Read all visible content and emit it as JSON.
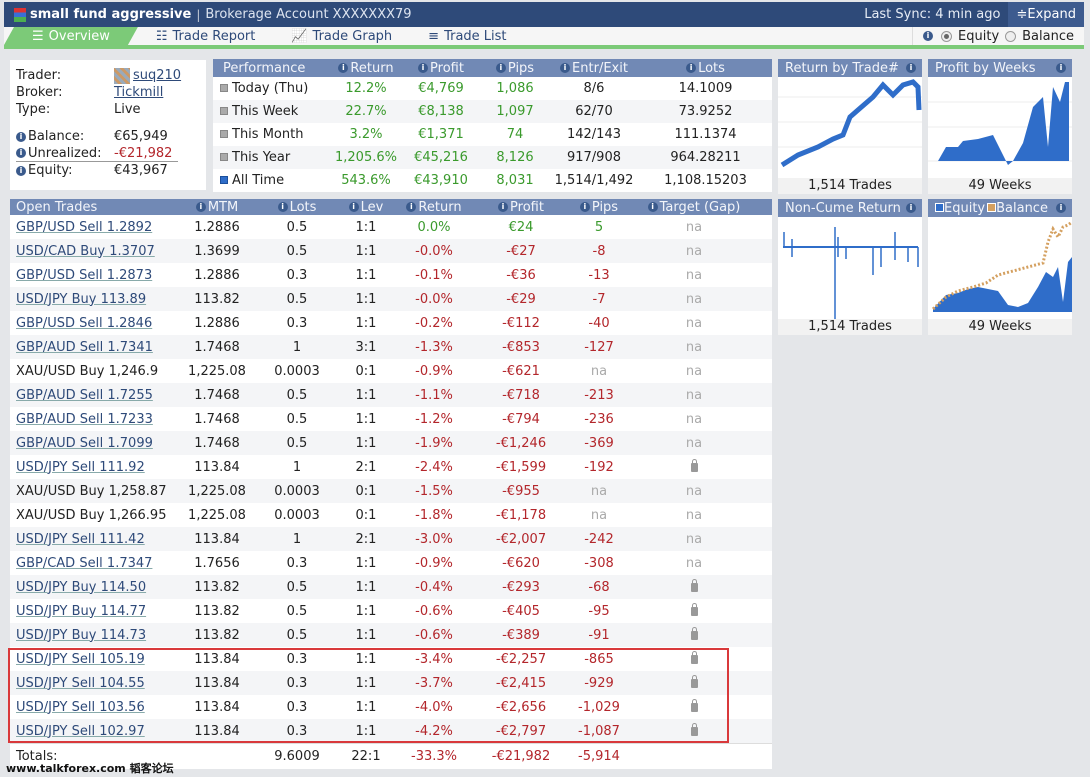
{
  "header": {
    "name": "small fund aggressive",
    "separator": "|",
    "account": "Brokerage Account XXXXXXX79",
    "sync": "Last Sync: 4 min ago",
    "expand": "≑Expand"
  },
  "tabs": [
    {
      "label": "Overview",
      "icon": "☰"
    },
    {
      "label": "Trade Report",
      "icon": "☷"
    },
    {
      "label": "Trade Graph",
      "icon": "📈"
    },
    {
      "label": "Trade List",
      "icon": "≡"
    }
  ],
  "mode": {
    "equity": "Equity",
    "balance": "Balance",
    "selected": "Equity"
  },
  "info": {
    "trader_label": "Trader:",
    "trader": "suq210",
    "broker_label": "Broker:",
    "broker": "Tickmill",
    "type_label": "Type:",
    "type": "Live",
    "balance_label": "Balance:",
    "balance": "€65,949",
    "unrealized_label": "Unrealized:",
    "unrealized": "-€21,982",
    "equity_label": "Equity:",
    "equity": "€43,967"
  },
  "performance": {
    "headers": [
      "Performance",
      "Return",
      "Profit",
      "Pips",
      "Entr/Exit",
      "Lots"
    ],
    "rows": [
      [
        "Today (Thu)",
        "12.2%",
        "€4,769",
        "1,086",
        "8/6",
        "14.1009"
      ],
      [
        "This Week",
        "22.7%",
        "€8,138",
        "1,097",
        "62/70",
        "73.9252"
      ],
      [
        "This Month",
        "3.2%",
        "€1,371",
        "74",
        "142/143",
        "111.1374"
      ],
      [
        "This Year",
        "1,205.6%",
        "€45,216",
        "8,126",
        "917/908",
        "964.28211"
      ],
      [
        "All Time",
        "543.6%",
        "€43,910",
        "8,031",
        "1,514/1,492",
        "1,108.15203"
      ]
    ]
  },
  "panels": {
    "return_by_trade": {
      "title": "Return by Trade#",
      "foot": "1,514 Trades"
    },
    "profit_by_weeks": {
      "title": "Profit by Weeks",
      "foot": "49 Weeks"
    },
    "non_cume": {
      "title": "Non-Cume Return",
      "foot": "1,514 Trades"
    },
    "equity_balance": {
      "equity": "Equity",
      "balance": "Balance",
      "foot": "49 Weeks",
      "equity_color": "#2f6dc9",
      "balance_color": "#d4a060"
    }
  },
  "trades": {
    "headers": [
      "Open Trades",
      "MTM",
      "Lots",
      "Lev",
      "Return",
      "Profit",
      "Pips",
      "Target (Gap)"
    ],
    "rows": [
      [
        "GBP/USD Sell 1.2892",
        "1.2886",
        "0.5",
        "1:1",
        "0.0%",
        "€24",
        "5",
        "na",
        true,
        "pos"
      ],
      [
        "USD/CAD Buy 1.3707",
        "1.3699",
        "0.5",
        "1:1",
        "-0.0%",
        "-€27",
        "-8",
        "na",
        true,
        "neg"
      ],
      [
        "GBP/USD Sell 1.2873",
        "1.2886",
        "0.3",
        "1:1",
        "-0.1%",
        "-€36",
        "-13",
        "na",
        true,
        "neg"
      ],
      [
        "USD/JPY Buy 113.89",
        "113.82",
        "0.5",
        "1:1",
        "-0.0%",
        "-€29",
        "-7",
        "na",
        true,
        "neg"
      ],
      [
        "GBP/USD Sell 1.2846",
        "1.2886",
        "0.3",
        "1:1",
        "-0.2%",
        "-€112",
        "-40",
        "na",
        true,
        "neg"
      ],
      [
        "GBP/AUD Sell 1.7341",
        "1.7468",
        "1",
        "3:1",
        "-1.3%",
        "-€853",
        "-127",
        "na",
        true,
        "neg"
      ],
      [
        "XAU/USD Buy 1,246.9",
        "1,225.08",
        "0.0003",
        "0:1",
        "-0.9%",
        "-€621",
        "na",
        "na",
        false,
        "neg"
      ],
      [
        "GBP/AUD Sell 1.7255",
        "1.7468",
        "0.5",
        "1:1",
        "-1.1%",
        "-€718",
        "-213",
        "na",
        true,
        "neg"
      ],
      [
        "GBP/AUD Sell 1.7233",
        "1.7468",
        "0.5",
        "1:1",
        "-1.2%",
        "-€794",
        "-236",
        "na",
        true,
        "neg"
      ],
      [
        "GBP/AUD Sell 1.7099",
        "1.7468",
        "0.5",
        "1:1",
        "-1.9%",
        "-€1,246",
        "-369",
        "na",
        true,
        "neg"
      ],
      [
        "USD/JPY Sell 111.92",
        "113.84",
        "1",
        "2:1",
        "-2.4%",
        "-€1,599",
        "-192",
        "lock",
        true,
        "neg"
      ],
      [
        "XAU/USD Buy 1,258.87",
        "1,225.08",
        "0.0003",
        "0:1",
        "-1.5%",
        "-€955",
        "na",
        "na",
        false,
        "neg"
      ],
      [
        "XAU/USD Buy 1,266.95",
        "1,225.08",
        "0.0003",
        "0:1",
        "-1.8%",
        "-€1,178",
        "na",
        "na",
        false,
        "neg"
      ],
      [
        "USD/JPY Sell 111.42",
        "113.84",
        "1",
        "2:1",
        "-3.0%",
        "-€2,007",
        "-242",
        "na",
        true,
        "neg"
      ],
      [
        "GBP/CAD Sell 1.7347",
        "1.7656",
        "0.3",
        "1:1",
        "-0.9%",
        "-€620",
        "-308",
        "na",
        true,
        "neg"
      ],
      [
        "USD/JPY Buy 114.50",
        "113.82",
        "0.5",
        "1:1",
        "-0.4%",
        "-€293",
        "-68",
        "lock",
        true,
        "neg"
      ],
      [
        "USD/JPY Buy 114.77",
        "113.82",
        "0.5",
        "1:1",
        "-0.6%",
        "-€405",
        "-95",
        "lock",
        true,
        "neg"
      ],
      [
        "USD/JPY Buy 114.73",
        "113.82",
        "0.5",
        "1:1",
        "-0.6%",
        "-€389",
        "-91",
        "lock",
        true,
        "neg"
      ],
      [
        "USD/JPY Sell 105.19",
        "113.84",
        "0.3",
        "1:1",
        "-3.4%",
        "-€2,257",
        "-865",
        "lock",
        true,
        "neg"
      ],
      [
        "USD/JPY Sell 104.55",
        "113.84",
        "0.3",
        "1:1",
        "-3.7%",
        "-€2,415",
        "-929",
        "lock",
        true,
        "neg"
      ],
      [
        "USD/JPY Sell 103.56",
        "113.84",
        "0.3",
        "1:1",
        "-4.0%",
        "-€2,656",
        "-1,029",
        "lock",
        true,
        "neg"
      ],
      [
        "USD/JPY Sell 102.97",
        "113.84",
        "0.3",
        "1:1",
        "-4.2%",
        "-€2,797",
        "-1,087",
        "lock",
        true,
        "neg"
      ]
    ],
    "totals": {
      "label": "Totals:",
      "lots": "9.6009",
      "lev": "22:1",
      "return": "-33.3%",
      "profit": "-€21,982",
      "pips": "-5,914"
    }
  },
  "watermark": "www.talkforex.com 韬客论坛"
}
